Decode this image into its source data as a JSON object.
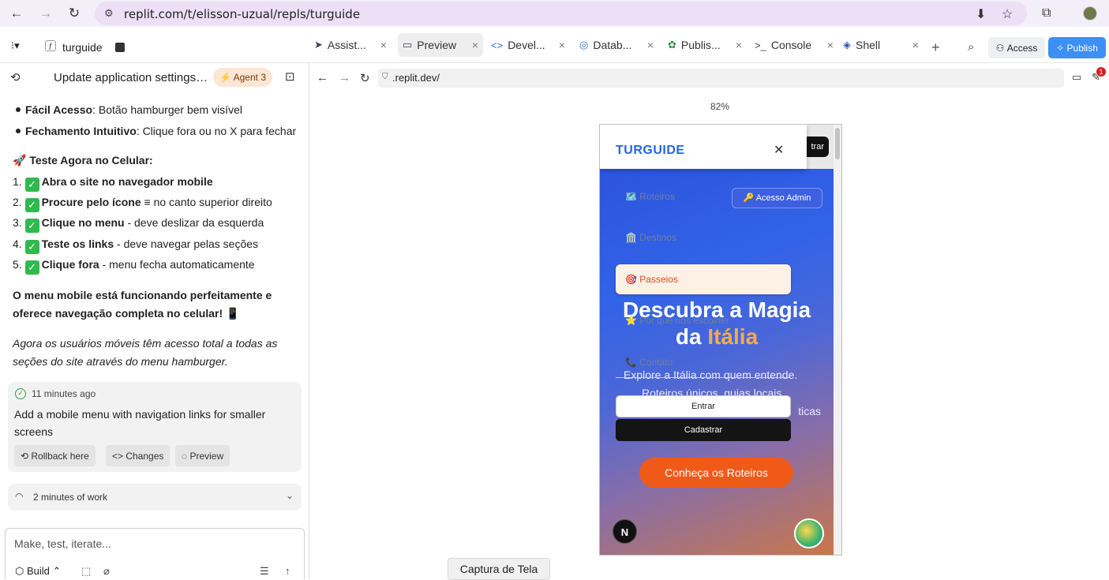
{
  "browser": {
    "url": "replit.com/t/elisson-uzual/repls/turguide"
  },
  "workspace": {
    "repl_name": "turguide",
    "tabs": [
      {
        "label": "Assist..."
      },
      {
        "label": "Preview"
      },
      {
        "label": "Devel..."
      },
      {
        "label": "Datab..."
      },
      {
        "label": "Publis..."
      },
      {
        "label": "Console"
      },
      {
        "label": "Shell"
      }
    ],
    "access_label": "Access",
    "publish_label": "Publish"
  },
  "chat": {
    "title": "Update application settings t...",
    "agent_badge": "Agent 3",
    "bullets": [
      {
        "bold": "Fácil Acesso",
        "text": ": Botão hamburger bem visível"
      },
      {
        "bold": "Fechamento Intuitivo",
        "text": ": Clique fora ou no X para fechar"
      }
    ],
    "test_heading": "🚀 Teste Agora no Celular:",
    "steps": [
      {
        "num": "1.",
        "bold": "Abra o site no navegador mobile",
        "text": ""
      },
      {
        "num": "2.",
        "bold": "Procure pelo ícone",
        "text": " ≡ no canto superior direito"
      },
      {
        "num": "3.",
        "bold": "Clique no menu",
        "text": " - deve deslizar da esquerda"
      },
      {
        "num": "4.",
        "bold": "Teste os links",
        "text": " - deve navegar pelas seções"
      },
      {
        "num": "5.",
        "bold": "Clique fora",
        "text": " - menu fecha automaticamente"
      }
    ],
    "summary_line1": "O menu mobile está funcionando perfeitamente e",
    "summary_line2": "oferece navegação completa no celular! 📱",
    "italic_line1": "Agora os usuários móveis têm acesso total a todas as",
    "italic_line2": "seções do site através do menu hamburger.",
    "checkpoint": {
      "time": "11 minutes ago",
      "description": "Add a mobile menu with navigation links for smaller screens",
      "rollback": "Rollback here",
      "changes": "Changes",
      "preview": "Preview"
    },
    "work_summary": "2 minutes of work",
    "input_placeholder": "Make, test, iterate...",
    "build_label": "Build"
  },
  "preview": {
    "address": ".replit.dev/",
    "zoom": "82%",
    "notification_count": "1",
    "site": {
      "brand": "TURGUIDE",
      "entrar_top": "trar",
      "admin_button": "🔑 Acesso Admin",
      "menu": [
        {
          "label": "🗺️ Roteiros"
        },
        {
          "label": "🏛️ Destinos"
        },
        {
          "label": "🎯 Passeios"
        },
        {
          "label": "⭐ Por que nos escolher"
        },
        {
          "label": "📞 Contato"
        }
      ],
      "hero_line1": "Descubra a Magia",
      "hero_line2_plain": "da ",
      "hero_line2_accent": "Itália",
      "sub_line1": "Explore a Itália com quem entende.",
      "sub_line2": "Roteiros únicos, guias locais",
      "sub_line3": "ticas",
      "btn_entrar": "Entrar",
      "btn_cadastrar": "Cadastrar",
      "cta": "Conheça os Roteiros",
      "n_badge": "N"
    }
  },
  "tooltip": "Captura de Tela",
  "colors": {
    "accent_orange": "#f05a19",
    "publish_blue": "#3b8ff5",
    "brand_blue": "#2563eb"
  }
}
